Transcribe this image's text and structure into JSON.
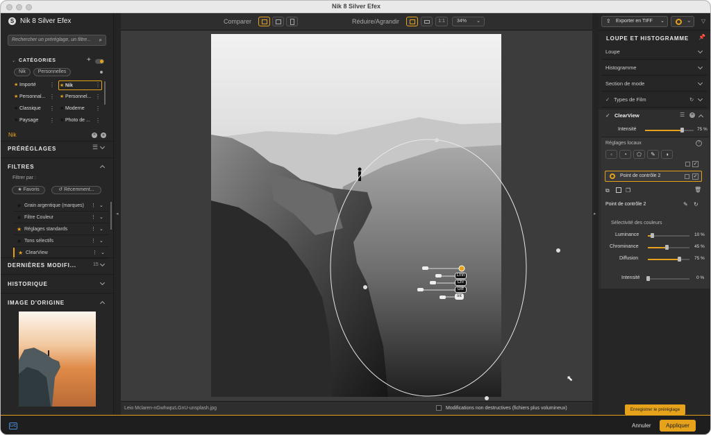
{
  "window": {
    "title": "Nik 8 Silver Efex"
  },
  "left": {
    "search_placeholder": "Rechercher un préréglage, un filtre...",
    "categories_title": "CATÉGORIES",
    "tabs": [
      "Nik",
      "Personnelles"
    ],
    "cats": [
      [
        "Importé",
        "Nik"
      ],
      [
        "Personnal...",
        "Personnel..."
      ],
      [
        "Classique",
        "Moderne"
      ],
      [
        "Paysage",
        "Photo de ..."
      ]
    ],
    "nik_label": "Nik",
    "presets_title": "PRÉRÉGLAGES",
    "filters_title": "FILTRES",
    "filter_by": "Filtrer par :",
    "favorites": "Favoris",
    "recent": "Récemment...",
    "filters": [
      "Grain argentique (marques)",
      "Filtre Couleur",
      "Réglages standards",
      "Tons sélectifs",
      "ClearView"
    ],
    "recent_title": "DERNIÈRES MODIFI...",
    "recent_count": "15",
    "history_title": "HISTORIQUE",
    "origin_title": "IMAGE D'ORIGINE"
  },
  "toolbar": {
    "compare": "Comparer",
    "zoom_label": "Réduire/Agrandir",
    "one_to_one": "1:1",
    "zoom_value": "34%"
  },
  "canvas": {
    "filename": "Leio Mclaren-nGwhwpzLGnU-unsplash.jpg",
    "nondestructive": "Modifications non destructives (fichiers plus volumineux)",
    "cp_tags": [
      "Lmn",
      "Chr",
      "Diff",
      "Int"
    ]
  },
  "right": {
    "export": "Exporter en TIFF",
    "panel_title": "LOUPE ET HISTOGRAMME",
    "sections": [
      "Loupe",
      "Histogramme",
      "Section de mode",
      "Types de Film"
    ],
    "filter_name": "ClearView",
    "intensity_label": "Intensité",
    "intensity_value": "75 %",
    "intensity_frac": 0.75,
    "local_title": "Réglages locaux",
    "cp_item": "Point de contrôle 2",
    "cp_name": "Point de contrôle 2",
    "selectivity": "Sélectivité des couleurs",
    "sliders": [
      {
        "label": "Luminance",
        "value": "10 %",
        "frac": 0.1
      },
      {
        "label": "Chrominance",
        "value": "45 %",
        "frac": 0.45
      },
      {
        "label": "Diffusion",
        "value": "75 %",
        "frac": 0.75
      }
    ],
    "local_intensity_label": "Intensité",
    "local_intensity_value": "0 %",
    "local_intensity_frac": 0,
    "save_preset": "Enregistrer le préréglage"
  },
  "bottom": {
    "lrc": "LrC",
    "cancel": "Annuler",
    "apply": "Appliquer"
  },
  "colors": {
    "accent": "#e6a21a",
    "panel": "#262626",
    "canvas": "#3c3c3c"
  }
}
